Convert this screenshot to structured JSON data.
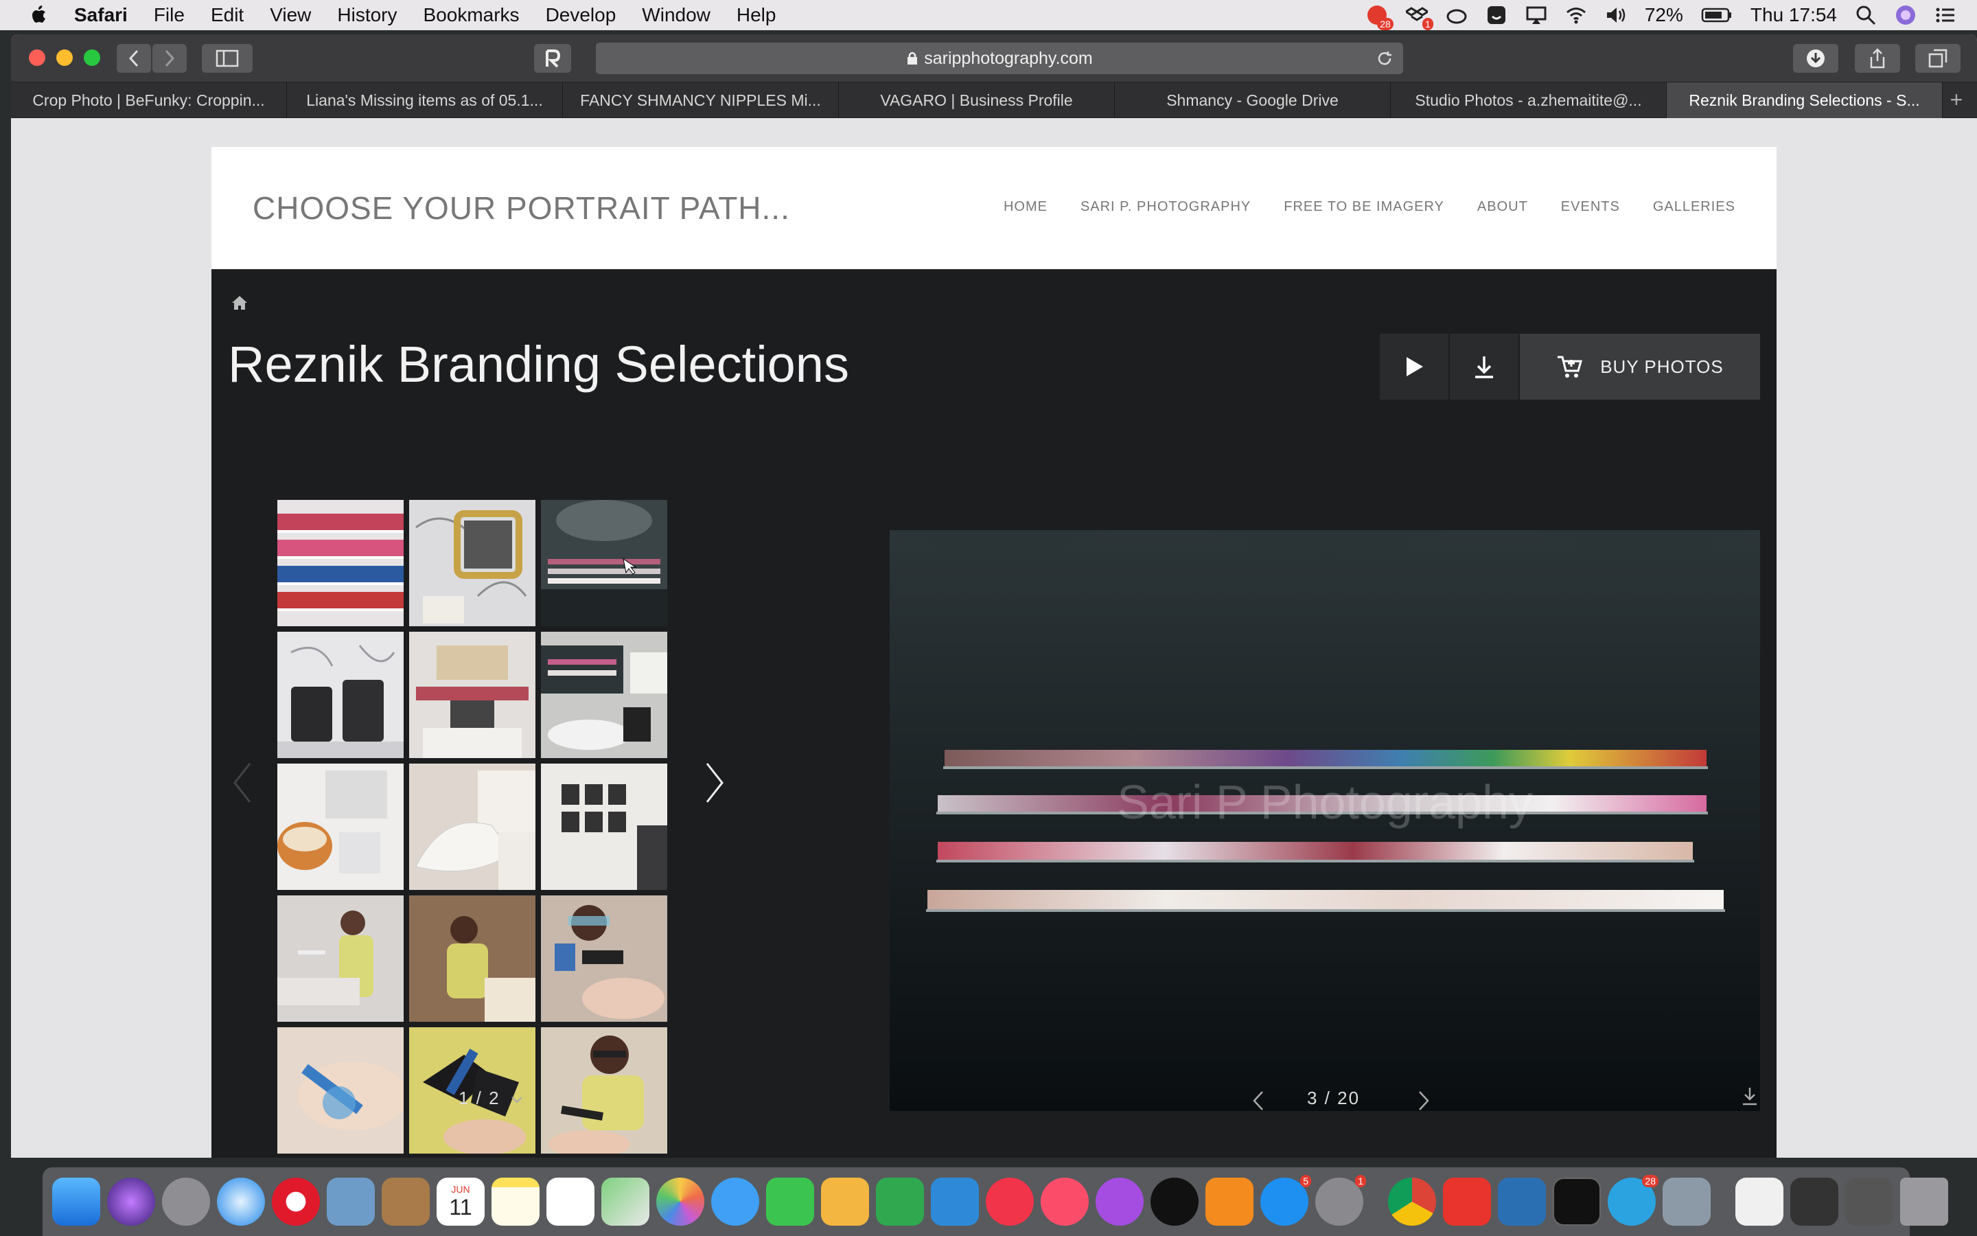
{
  "menubar": {
    "app": "Safari",
    "items": [
      "File",
      "Edit",
      "View",
      "History",
      "Bookmarks",
      "Develop",
      "Window",
      "Help"
    ],
    "battery": "72%",
    "clock": "Thu 17:54",
    "notif_badge": "28",
    "dropbox_badge": "1"
  },
  "browser": {
    "url": "saripphotography.com",
    "tabs": [
      "Crop Photo | BeFunky: Croppin...",
      "Liana's Missing items as of 05.1...",
      "FANCY SHMANCY NIPPLES Mi...",
      "VAGARO | Business Profile",
      "Shmancy - Google Drive",
      "Studio Photos - a.zhemaitite@...",
      "Reznik Branding Selections - S..."
    ]
  },
  "site": {
    "title": "CHOOSE YOUR PORTRAIT PATH...",
    "nav": [
      "HOME",
      "SARI P. PHOTOGRAPHY",
      "FREE TO BE IMAGERY",
      "ABOUT",
      "EVENTS",
      "GALLERIES"
    ]
  },
  "gallery": {
    "title": "Reznik Branding Selections",
    "buy_label": "BUY PHOTOS",
    "thumb_page": "1 / 2",
    "photo_counter": "3 / 20",
    "watermark": "Sari P Photography"
  },
  "colors": {
    "gallery_bg": "#1c1d1f",
    "header_bg": "#ffffff",
    "accent_red": "#e23b2e"
  },
  "dock": {
    "badges": {
      "appstore": "5",
      "settings": "1",
      "telegram": "28"
    },
    "calendar_month": "JUN",
    "calendar_day": "11"
  }
}
